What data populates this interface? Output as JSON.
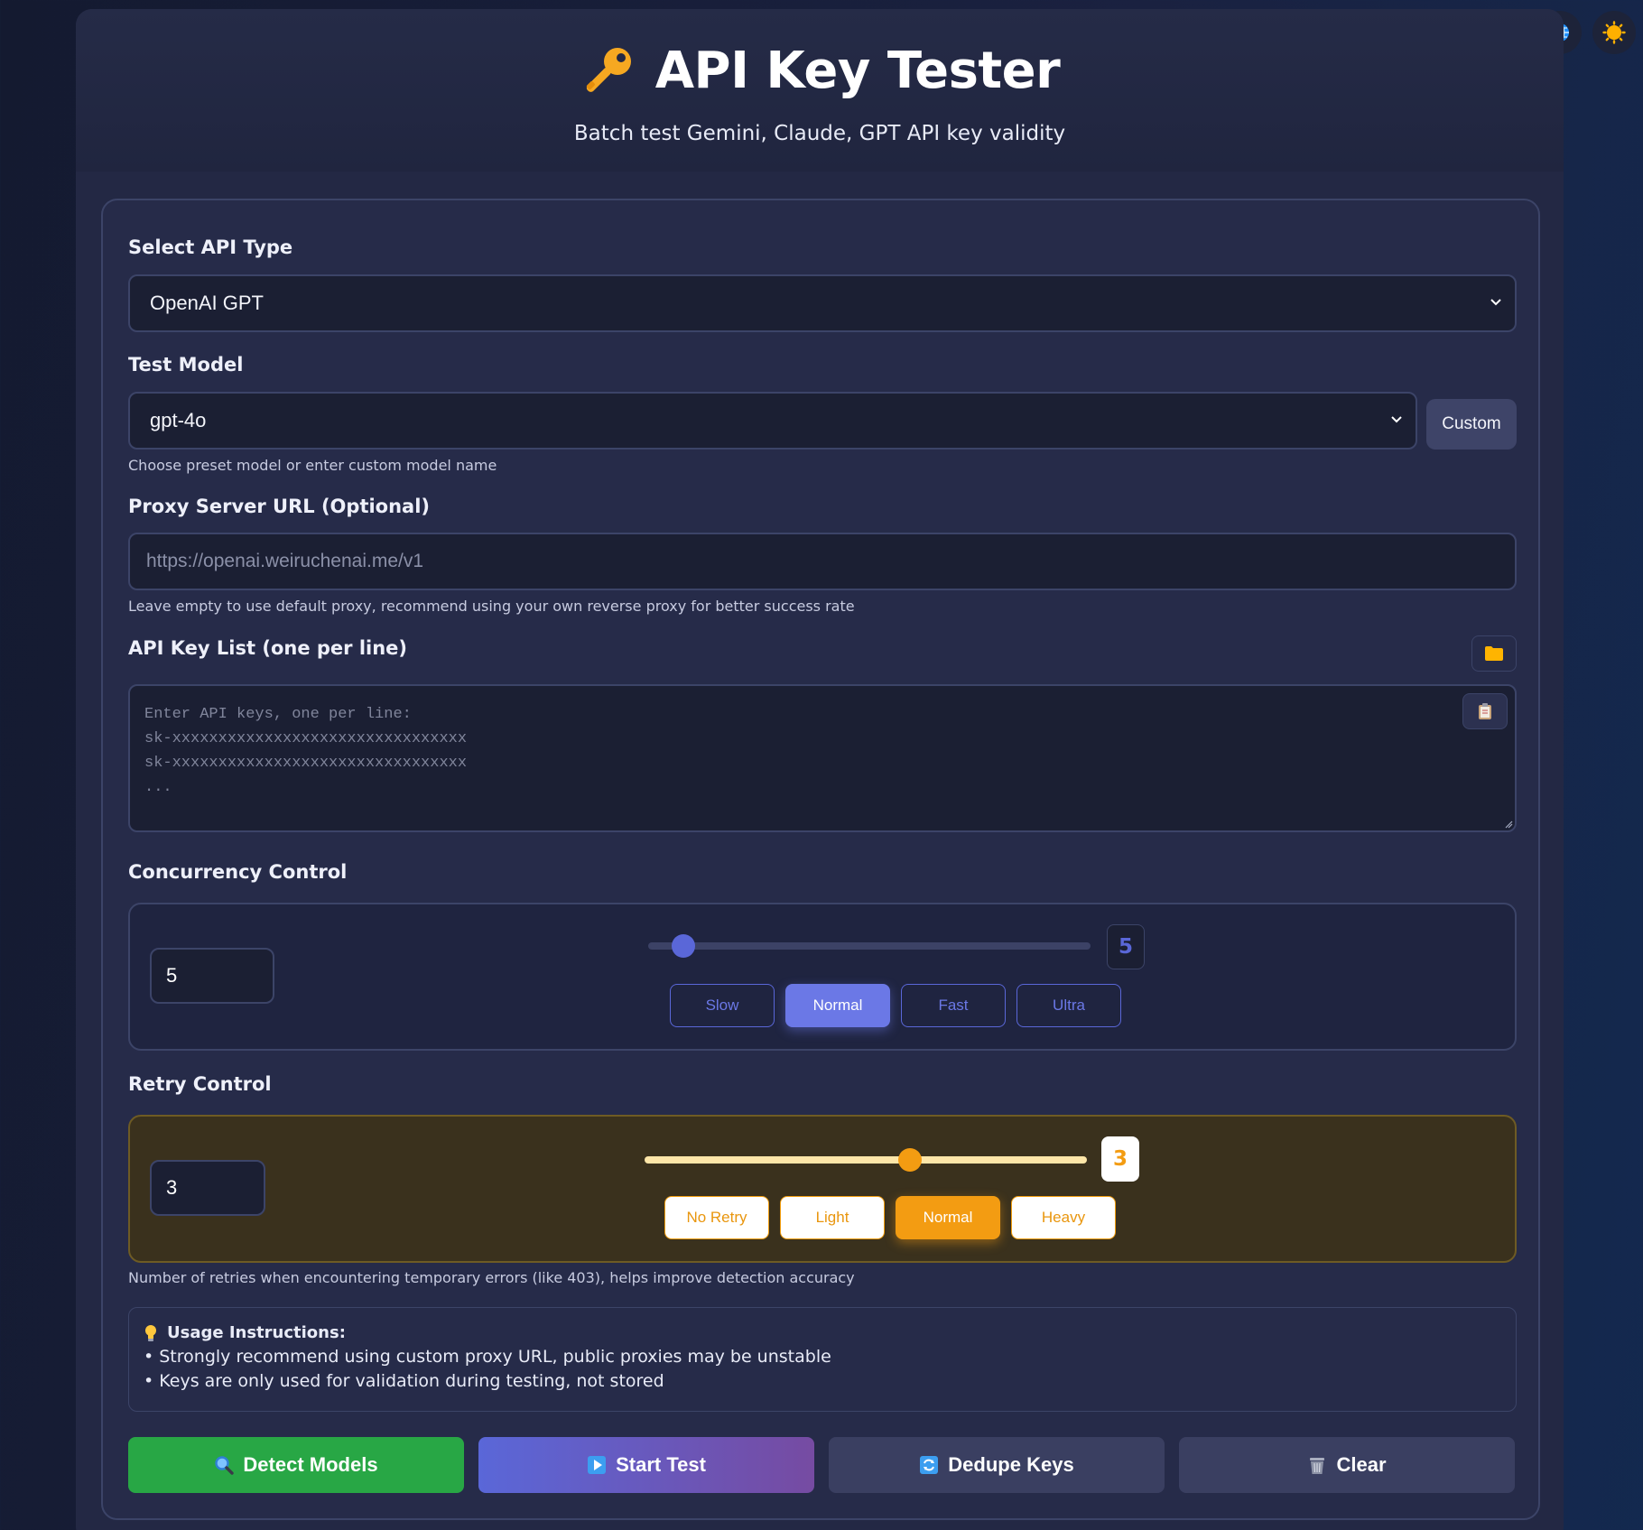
{
  "header": {
    "title": "API Key Tester",
    "subtitle": "Batch test Gemini, Claude, GPT API key validity"
  },
  "top_icons": [
    "globe-icon",
    "sun-icon"
  ],
  "api_type": {
    "label": "Select API Type",
    "selected": "OpenAI GPT"
  },
  "model": {
    "label": "Test Model",
    "selected": "gpt-4o",
    "custom_button": "Custom",
    "hint": "Choose preset model or enter custom model name"
  },
  "proxy": {
    "label": "Proxy Server URL (Optional)",
    "placeholder": "https://openai.weiruchenai.me/v1",
    "hint": "Leave empty to use default proxy, recommend using your own reverse proxy for better success rate"
  },
  "keys": {
    "label": "API Key List (one per line)",
    "placeholder_lines": [
      "Enter API keys, one per line:",
      "sk-xxxxxxxxxxxxxxxxxxxxxxxxxxxxxxxx",
      "sk-xxxxxxxxxxxxxxxxxxxxxxxxxxxxxxxx",
      "..."
    ]
  },
  "concurrency": {
    "label": "Concurrency Control",
    "value": "5",
    "slider_fraction": 0.08,
    "badge": "5",
    "presets": [
      "Slow",
      "Normal",
      "Fast",
      "Ultra"
    ],
    "active_preset": "Normal"
  },
  "retry": {
    "label": "Retry Control",
    "value": "3",
    "slider_fraction": 0.6,
    "badge": "3",
    "presets": [
      "No Retry",
      "Light",
      "Normal",
      "Heavy"
    ],
    "active_preset": "Normal",
    "hint": "Number of retries when encountering temporary errors (like 403), helps improve detection accuracy"
  },
  "instructions": {
    "title": "Usage Instructions:",
    "lines": [
      "• Strongly recommend using custom proxy URL, public proxies may be unstable",
      "• Keys are only used for validation during testing, not stored"
    ]
  },
  "actions": {
    "detect": "Detect Models",
    "start": "Start Test",
    "dedupe": "Dedupe Keys",
    "clear": "Clear"
  },
  "colors": {
    "accent_blue": "#6b78e6",
    "accent_orange": "#f39c12",
    "detect_green": "#28a745",
    "start_gradient": [
      "#5a67d8",
      "#764ba2"
    ]
  }
}
